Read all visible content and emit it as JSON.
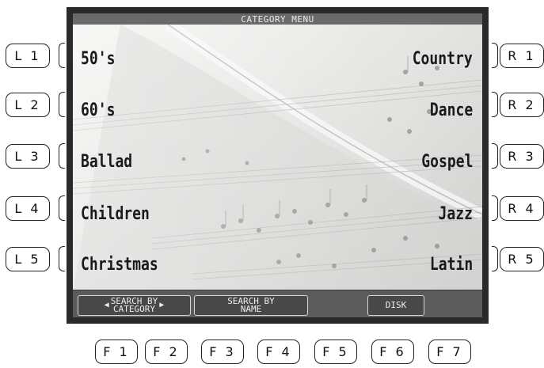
{
  "screen": {
    "title": "CATEGORY MENU"
  },
  "left_buttons": [
    "L 1",
    "L 2",
    "L 3",
    "L 4",
    "L 5"
  ],
  "right_buttons": [
    "R 1",
    "R 2",
    "R 3",
    "R 4",
    "R 5"
  ],
  "function_buttons": [
    "F 1",
    "F 2",
    "F 3",
    "F 4",
    "F 5",
    "F 6",
    "F 7"
  ],
  "categories": {
    "left": [
      "50's",
      "60's",
      "Ballad",
      "Children",
      "Christmas"
    ],
    "right": [
      "Country",
      "Dance",
      "Gospel",
      "Jazz",
      "Latin"
    ]
  },
  "soft_buttons": {
    "search_by_category": {
      "line1": "SEARCH BY",
      "line2": "CATEGORY"
    },
    "search_by_name": {
      "line1": "SEARCH BY",
      "line2": "NAME"
    },
    "disk": "DISK"
  }
}
